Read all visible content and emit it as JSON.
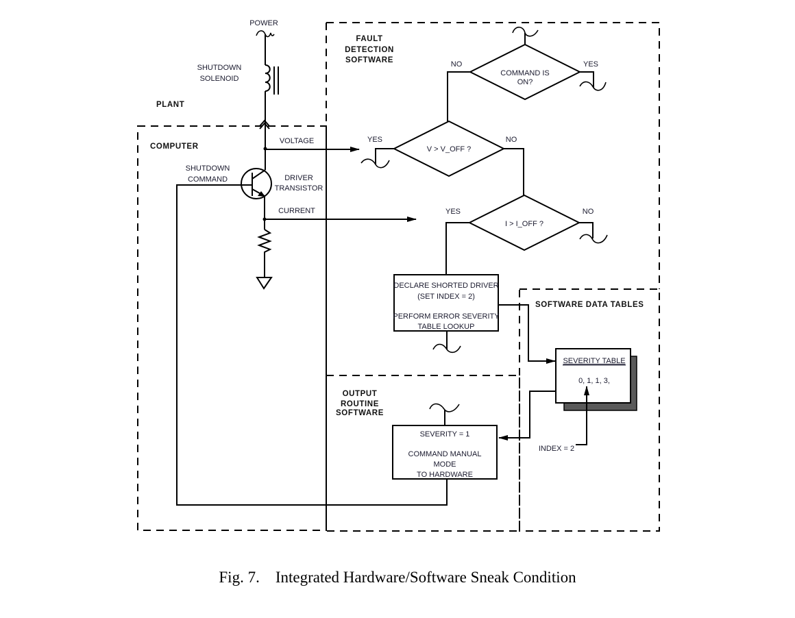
{
  "caption": {
    "figure_number": "Fig. 7.",
    "title": "Integrated Hardware/Software Sneak Condition"
  },
  "regions": {
    "plant": "PLANT",
    "computer": "COMPUTER",
    "fault_detection": [
      "FAULT",
      "DETECTION",
      "SOFTWARE"
    ],
    "output_routine": [
      "OUTPUT",
      "ROUTINE",
      "SOFTWARE"
    ],
    "data_tables": "SOFTWARE DATA TABLES"
  },
  "hardware": {
    "power": "POWER",
    "solenoid": [
      "SHUTDOWN",
      "SOLENOID"
    ],
    "shutdown_command": [
      "SHUTDOWN",
      "COMMAND"
    ],
    "driver_transistor": [
      "DRIVER",
      "TRANSISTOR"
    ],
    "voltage": "VOLTAGE",
    "current": "CURRENT"
  },
  "decisions": {
    "command_on": {
      "text": [
        "COMMAND IS",
        "ON?"
      ],
      "left": "NO",
      "right": "YES"
    },
    "v_check": {
      "text": "V > V_OFF ?",
      "left": "YES",
      "right": "NO"
    },
    "i_check": {
      "text": "I > I_OFF ?",
      "left": "YES",
      "right": "NO"
    }
  },
  "process_boxes": {
    "declare": [
      "DECLARE SHORTED DRIVER",
      "(SET INDEX = 2)",
      "PERFORM  ERROR SEVERITY",
      "TABLE LOOKUP"
    ],
    "output": [
      "SEVERITY = 1",
      "COMMAND MANUAL",
      "MODE",
      "TO HARDWARE"
    ]
  },
  "severity_table": {
    "title": "SEVERITY TABLE",
    "values": "0, 1,  1, 3,",
    "index_label": "INDEX = 2"
  },
  "colors": {
    "shadow": "#5a5a5a",
    "text": "#1a1a2e"
  }
}
